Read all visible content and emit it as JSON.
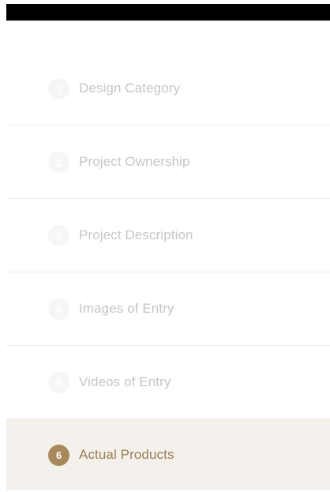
{
  "steps": [
    {
      "number": "1",
      "label": "Design Category"
    },
    {
      "number": "2",
      "label": "Project Ownership"
    },
    {
      "number": "3",
      "label": "Project Description"
    },
    {
      "number": "4",
      "label": "Images of Entry"
    },
    {
      "number": "5",
      "label": "Videos of Entry"
    },
    {
      "number": "6",
      "label": "Actual Products"
    }
  ],
  "active_step": "6",
  "colors": {
    "accent": "#a8895c",
    "active_background": "#f4f1ec",
    "inactive_text": "#c6c6c6",
    "divider": "#ececec"
  }
}
